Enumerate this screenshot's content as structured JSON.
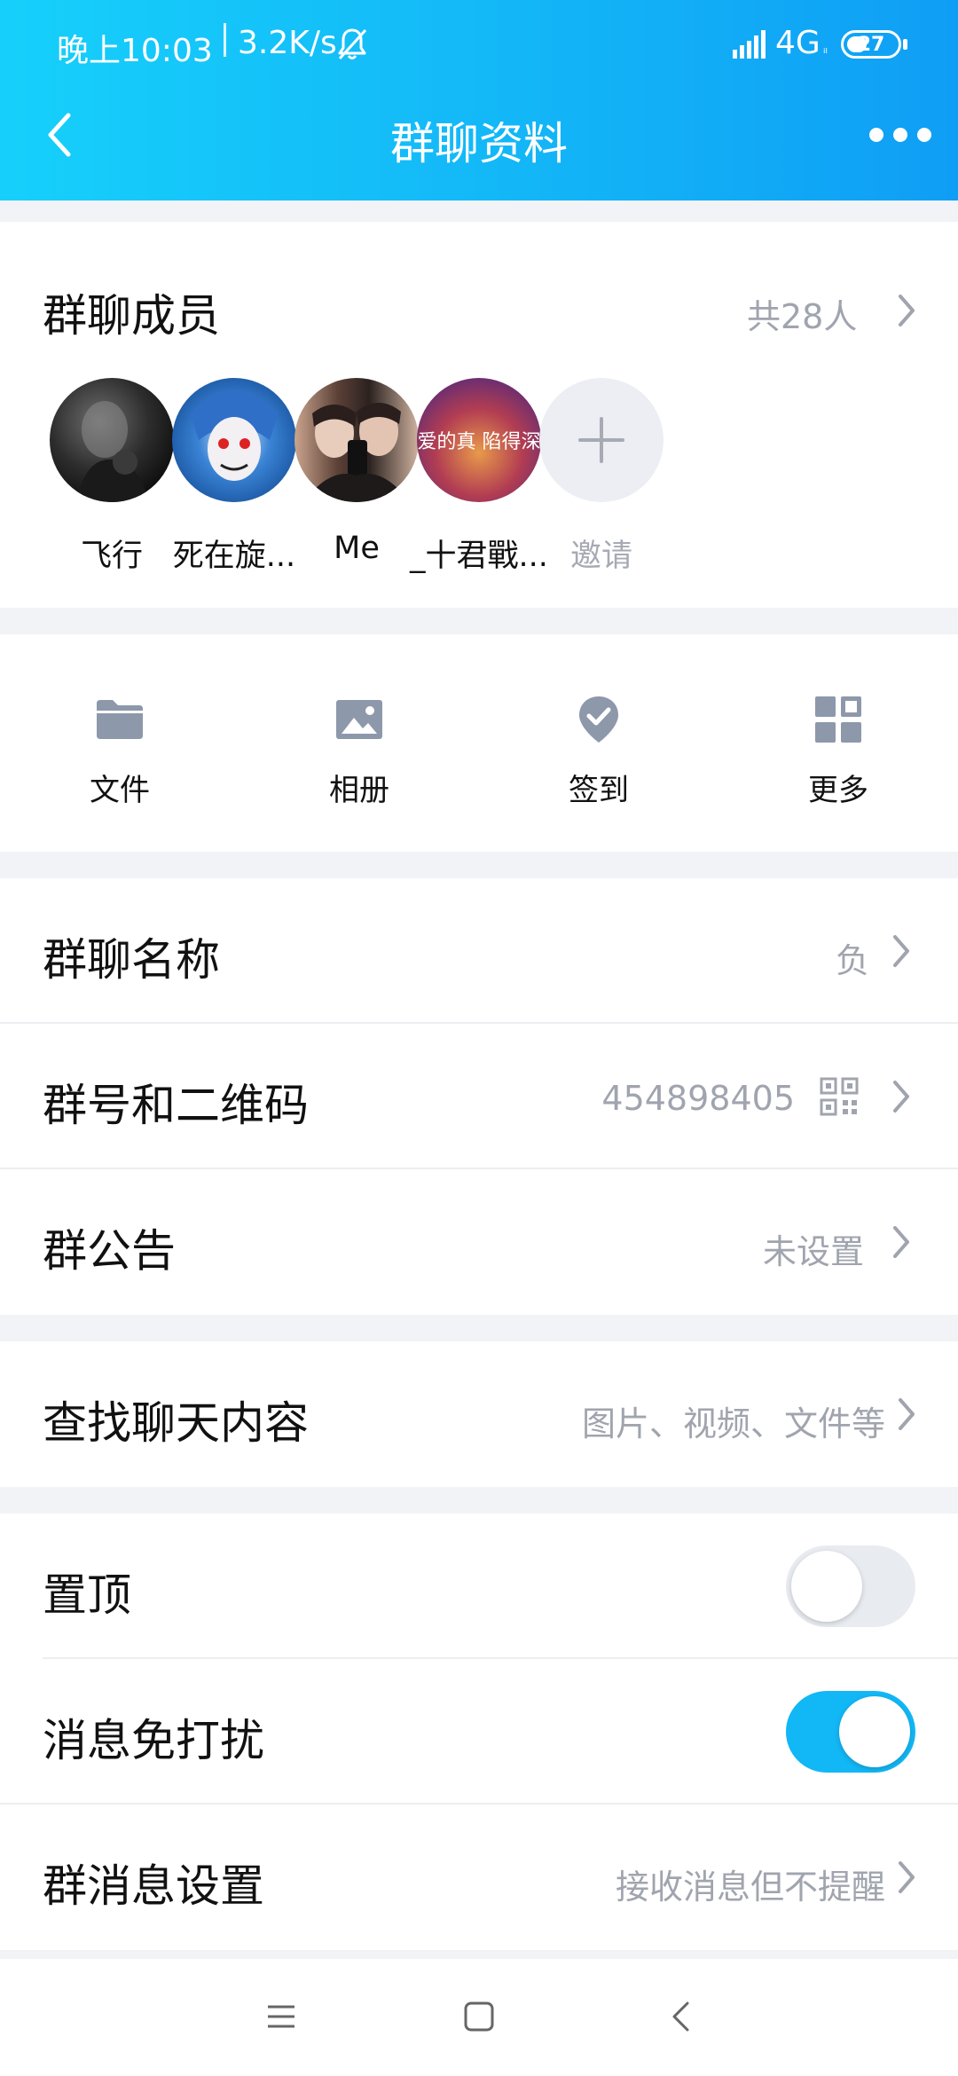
{
  "status_bar": {
    "time": "晚上10:03",
    "speed": "3.2K/s",
    "network": "4G",
    "network_sub": "ᵢₗ",
    "battery": "27",
    "icons": [
      "bell-mute-icon",
      "signal-icon",
      "battery-icon"
    ]
  },
  "nav": {
    "title": "群聊资料",
    "back_icon": "chevron-left-icon",
    "more_icon": "more-dots-icon"
  },
  "members": {
    "title": "群聊成员",
    "count": "共28人",
    "list": [
      {
        "name": "飞行"
      },
      {
        "name": "死在旋..."
      },
      {
        "name": "Me"
      },
      {
        "name": "_十君戰...",
        "avatar_text": "爱的真 陷得深"
      }
    ],
    "invite_label": "邀请"
  },
  "tools": [
    {
      "label": "文件",
      "icon": "folder-icon"
    },
    {
      "label": "相册",
      "icon": "image-icon"
    },
    {
      "label": "签到",
      "icon": "check-location-icon"
    },
    {
      "label": "更多",
      "icon": "grid-icon"
    }
  ],
  "settings": {
    "group_name": {
      "label": "群聊名称",
      "value": "负"
    },
    "group_number": {
      "label": "群号和二维码",
      "value": "454898405"
    },
    "announcement": {
      "label": "群公告",
      "value": "未设置"
    },
    "search_history": {
      "label": "查找聊天内容",
      "value": "图片、视频、文件等"
    },
    "pin_top": {
      "label": "置顶",
      "enabled": false
    },
    "do_not_disturb": {
      "label": "消息免打扰",
      "enabled": true
    },
    "message_settings": {
      "label": "群消息设置",
      "value": "接收消息但不提醒"
    }
  },
  "colors": {
    "header_start": "#16d0fb",
    "header_end": "#0f9ef5",
    "toggle_on": "#12b7f5",
    "secondary_text": "#a0a4ae",
    "icon_gray": "#8e98ab"
  }
}
